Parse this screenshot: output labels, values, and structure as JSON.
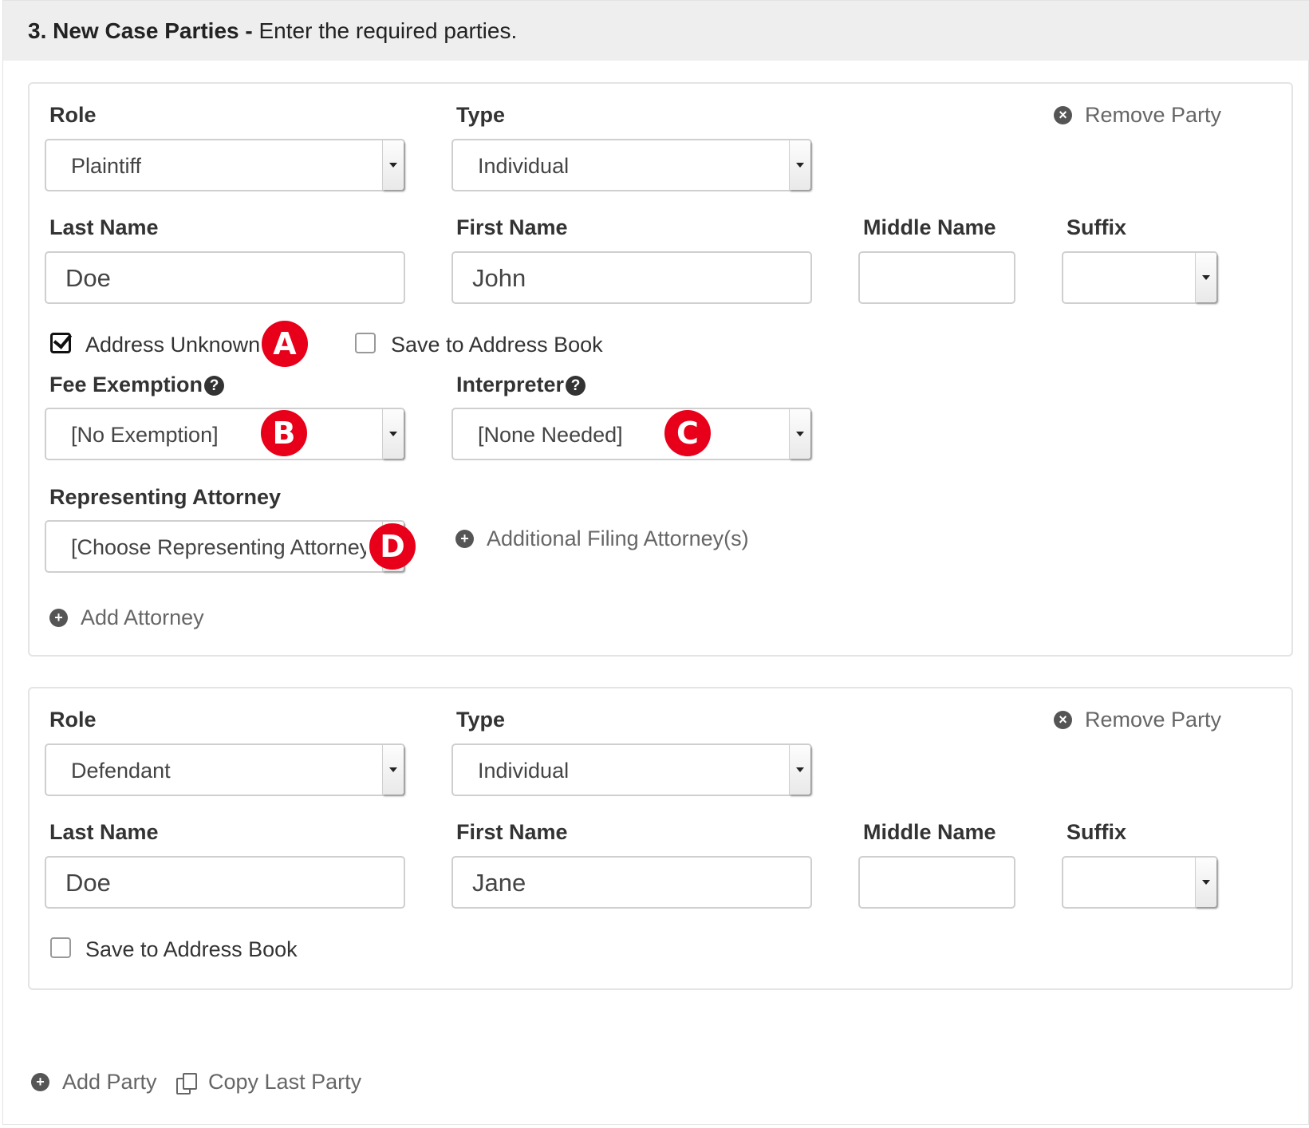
{
  "header": {
    "step": "3. New Case Parties -",
    "instruction": "Enter the required parties."
  },
  "party1": {
    "role_label": "Role",
    "role_value": "Plaintiff",
    "type_label": "Type",
    "type_value": "Individual",
    "remove_label": "Remove Party",
    "last_name_label": "Last Name",
    "last_name_value": "Doe",
    "first_name_label": "First Name",
    "first_name_value": "John",
    "middle_name_label": "Middle Name",
    "middle_name_value": "",
    "suffix_label": "Suffix",
    "suffix_value": "",
    "address_unknown_label": "Address Unknown",
    "address_unknown_checked": true,
    "save_address_label": "Save to Address Book",
    "save_address_checked": false,
    "fee_exemption_label": "Fee Exemption",
    "fee_exemption_value": "[No Exemption]",
    "interpreter_label": "Interpreter",
    "interpreter_value": "[None Needed]",
    "attorney_label": "Representing Attorney",
    "attorney_value": "[Choose Representing Attorney]",
    "additional_attorney_label": "Additional Filing Attorney(s)",
    "add_attorney_label": "Add Attorney"
  },
  "party2": {
    "role_label": "Role",
    "role_value": "Defendant",
    "type_label": "Type",
    "type_value": "Individual",
    "remove_label": "Remove Party",
    "last_name_label": "Last Name",
    "last_name_value": "Doe",
    "first_name_label": "First Name",
    "first_name_value": "Jane",
    "middle_name_label": "Middle Name",
    "middle_name_value": "",
    "suffix_label": "Suffix",
    "suffix_value": "",
    "save_address_label": "Save to Address Book",
    "save_address_checked": false
  },
  "footer": {
    "add_party_label": "Add Party",
    "copy_last_party_label": "Copy Last Party"
  },
  "markers": {
    "a": "A",
    "b": "B",
    "c": "C",
    "d": "D"
  },
  "icons": {
    "remove": "remove-circle-icon",
    "add": "plus-circle-icon",
    "help": "question-circle-icon",
    "copy": "copy-icon"
  },
  "colors": {
    "marker": "#e8001b",
    "header_bg": "#eeeeee"
  }
}
